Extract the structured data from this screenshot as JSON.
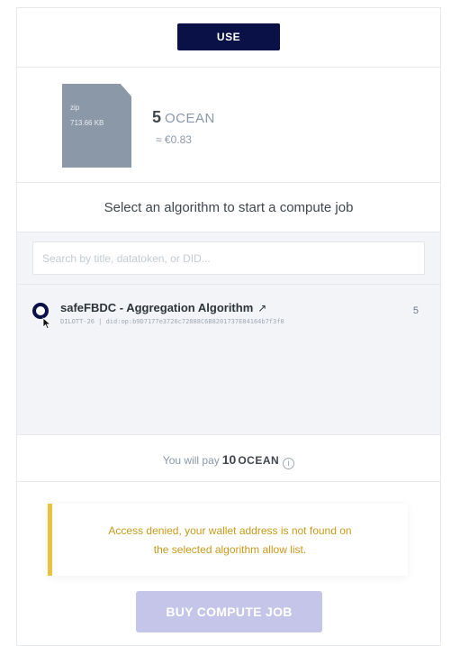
{
  "actions": {
    "use_label": "USE"
  },
  "asset": {
    "file_type": "zip",
    "file_size": "713.66 KB",
    "price_amount": "5",
    "price_symbol": "OCEAN",
    "price_fiat": "≈ €0.83"
  },
  "compute": {
    "prompt": "Select an algorithm to start a compute job",
    "search_placeholder": "Search by title, datatoken, or DID...",
    "algorithms": [
      {
        "title": "safeFBDC - Aggregation Algorithm",
        "symbol": "DILOTT-26",
        "separator": "|",
        "did": "did:op:b9D7177e3726c72888C6B8201737E84164b7f3f0",
        "price": "5",
        "selected": true
      }
    ],
    "total_prefix": "You will pay",
    "total_amount": "10",
    "total_symbol": "OCEAN"
  },
  "warning": {
    "line1": "Access denied, your wallet address is not found on",
    "line2": "the selected algorithm allow list."
  },
  "buy": {
    "label": "BUY COMPUTE JOB"
  },
  "icons": {
    "external_link": "external-link-icon",
    "info": "info-icon",
    "cursor": "cursor-icon"
  },
  "colors": {
    "primary": "#0a1147",
    "warning_accent": "#e9c33f",
    "warning_text": "#c79a1c",
    "disabled_button": "#c5c5e9"
  }
}
